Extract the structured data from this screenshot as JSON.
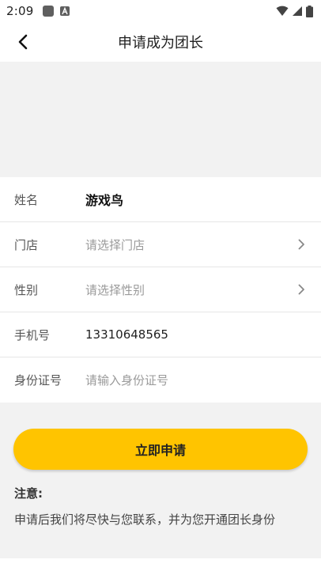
{
  "status_bar": {
    "time": "2:09"
  },
  "header": {
    "title": "申请成为团长"
  },
  "form": {
    "rows": [
      {
        "label": "姓名",
        "value": "游戏鸟"
      },
      {
        "label": "门店",
        "placeholder": "请选择门店"
      },
      {
        "label": "性别",
        "placeholder": "请选择性别"
      },
      {
        "label": "手机号",
        "value": "13310648565"
      },
      {
        "label": "身份证号",
        "placeholder": "请输入身份证号"
      }
    ]
  },
  "apply_button": {
    "label": "立即申请",
    "color": "#ffc400"
  },
  "notice": {
    "title": "注意:",
    "text": "申请后我们将尽快与您联系，并为您开通团长身份"
  }
}
